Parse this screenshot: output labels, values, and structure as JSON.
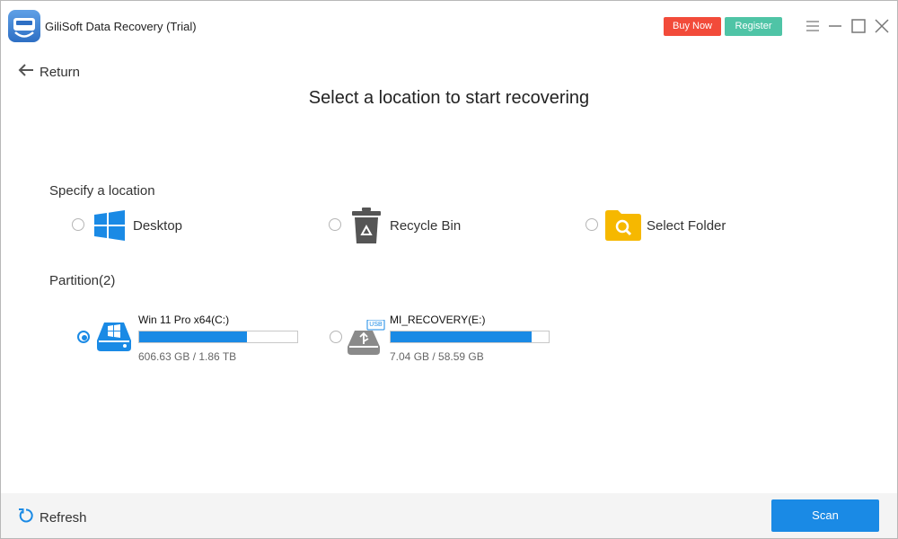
{
  "app": {
    "title": "GiliSoft Data Recovery (Trial)"
  },
  "header": {
    "buy_label": "Buy Now",
    "register_label": "Register"
  },
  "nav": {
    "return_label": "Return"
  },
  "main": {
    "heading": "Select a location to start recovering"
  },
  "locations": {
    "section_label": "Specify a location",
    "items": [
      {
        "label": "Desktop",
        "icon": "windows-icon",
        "selected": false
      },
      {
        "label": "Recycle Bin",
        "icon": "recycle-bin-icon",
        "selected": false
      },
      {
        "label": "Select Folder",
        "icon": "folder-search-icon",
        "selected": false
      }
    ]
  },
  "partitions": {
    "section_label": "Partition(2)",
    "items": [
      {
        "name": "Win 11 Pro x64(C:)",
        "size": "606.63 GB / 1.86 TB",
        "used_fraction": 0.68,
        "icon": "windows-drive-icon",
        "selected": true
      },
      {
        "name": "MI_RECOVERY(E:)",
        "size": "7.04 GB / 58.59 GB",
        "used_fraction": 0.89,
        "icon": "usb-drive-icon",
        "badge": "USB",
        "selected": false
      }
    ]
  },
  "footer": {
    "refresh_label": "Refresh",
    "scan_label": "Scan"
  },
  "colors": {
    "accent": "#1a8ae5",
    "buy": "#f24b3a",
    "register": "#4fc4a6",
    "folder": "#f6b800"
  }
}
